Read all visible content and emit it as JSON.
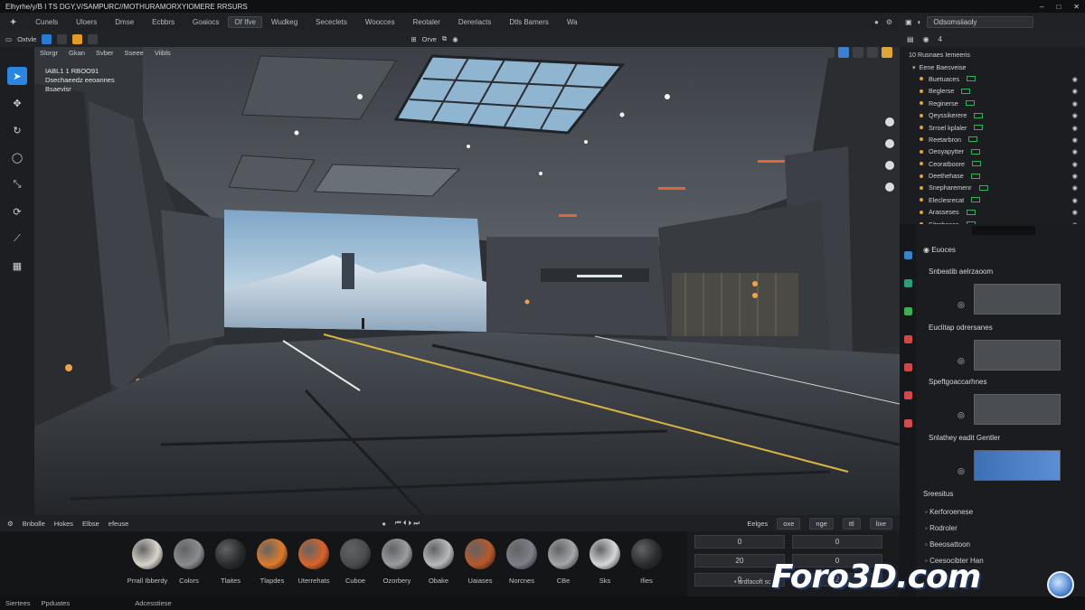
{
  "titlebar": {
    "title": "Elhyrhe/y/B I TS DGY,V/SAMPURC//MOTHURAMORXYIOMERE RRSURS",
    "controls": [
      "–",
      "□",
      "✕"
    ]
  },
  "menubar": {
    "items": [
      "Cunels",
      "Uloers",
      "Dmse",
      "Ecbbrs",
      "Goaiocs",
      "Of Ifve",
      "Wudkeg",
      "Sececlets",
      "Woocces",
      "Reotaler",
      "Dereriacts",
      "Dtls Bamers",
      "Wa"
    ],
    "highlight_index": 5
  },
  "topright": {
    "selector": "Odsomsiiaoly"
  },
  "viewport_header": {
    "mode": "Oxtvle",
    "right": "Orve"
  },
  "viewport": {
    "submenu": [
      "Slorgr",
      "Gkan",
      "Svber",
      "Sseee",
      "Viibls"
    ],
    "stats": [
      "IABL1 1 RBOO91",
      "Dsechaeedz eeoannes",
      "Bsaevisr"
    ]
  },
  "left_tools": [
    {
      "icon": "cursor-icon",
      "active": true
    },
    {
      "icon": "move-icon",
      "active": false
    },
    {
      "icon": "rotate-icon",
      "active": false
    },
    {
      "icon": "circle-tool-icon",
      "active": false
    },
    {
      "icon": "scale-icon",
      "active": false
    },
    {
      "icon": "transform-icon",
      "active": false
    },
    {
      "icon": "measure-icon",
      "active": false
    },
    {
      "icon": "graph-icon",
      "active": false
    }
  ],
  "asset_header": {
    "tabs": [
      "Bnbolle",
      "Hokes",
      "Elbse",
      "efeuse"
    ],
    "right_buttons": [
      "Eelges",
      "oxe",
      "nge",
      "ttl",
      "lixe"
    ]
  },
  "assets": [
    {
      "label": "Prrall Ibberdy",
      "color": "#d9d4cc"
    },
    {
      "label": "Colors",
      "color": "#8a8c90"
    },
    {
      "label": "Tlaites",
      "color": "#2a2b2e"
    },
    {
      "label": "Tlapdes",
      "color": "#e07a2a"
    },
    {
      "label": "Uterrehats",
      "color": "#d9632a"
    },
    {
      "label": "Cuboe",
      "color": "#4a4b4f"
    },
    {
      "label": "Ozorbery",
      "color": "#9a9ca0"
    },
    {
      "label": "Obake",
      "color": "#b7b9bc"
    },
    {
      "label": "Uaiases",
      "color": "#b8582a"
    },
    {
      "label": "Norcnes",
      "color": "#7c8088"
    },
    {
      "label": "CBe",
      "color": "#a4a7ab"
    },
    {
      "label": "Sks",
      "color": "#d5d7da"
    },
    {
      "label": "Ifies",
      "color": "#2a2c30"
    }
  ],
  "numbers": {
    "values": [
      "0",
      "0",
      "20",
      "0",
      "0",
      "2"
    ],
    "note": "• ardfacoft sc"
  },
  "statusbar": {
    "items": [
      "Siertees",
      "Ppduates",
      "Adcesstiese"
    ]
  },
  "outliner": {
    "header": "4",
    "title": "10 Rusnaes Iemeeris",
    "group": "Eene Baesveise",
    "rows": [
      "Buetuaces",
      "Beglerse",
      "Reginerse",
      "Qeyssikerere",
      "Srroel kplaler",
      "Reetarbron",
      "Oeoyapytter",
      "Ceoratboore",
      "Deethehase",
      "Snepharemenr",
      "Eleclesrecat",
      "Arasseses",
      "Sitrsbesca"
    ]
  },
  "props": {
    "header": "Euoces",
    "sections": [
      "Snbeatib aelrzaoom",
      "Euclitap odrersanes",
      "Speftgoaccarhnes",
      "Snlathey eadit Gentler"
    ],
    "list_title": "Sreesitus",
    "list": [
      "Kerforoenese",
      "Rodroler",
      "Beeosattoon",
      "Ceesocibter Han"
    ]
  },
  "watermark": "Foro3D.com"
}
